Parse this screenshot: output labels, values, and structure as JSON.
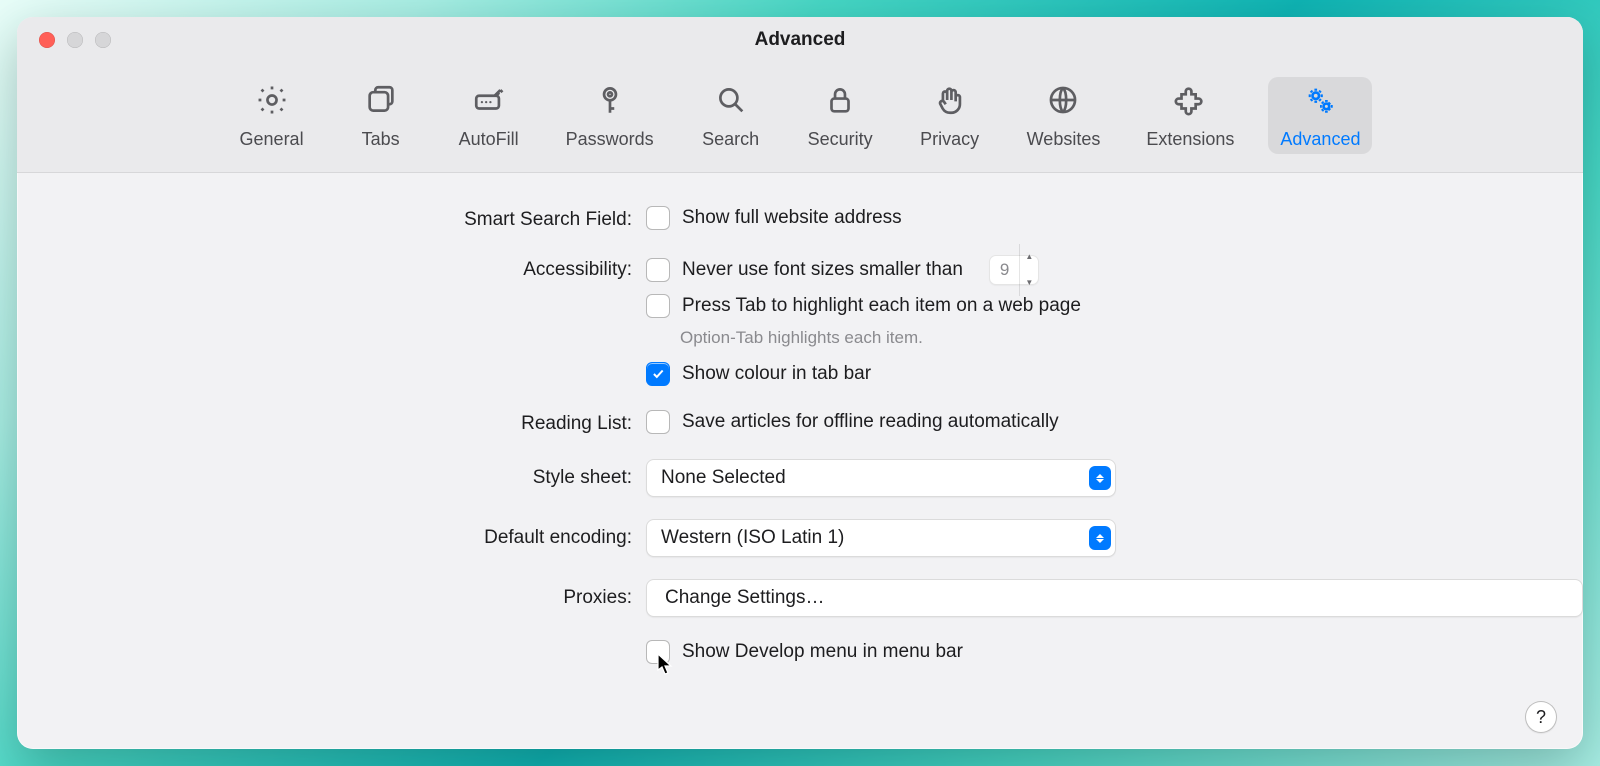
{
  "window": {
    "title": "Advanced"
  },
  "toolbar": {
    "tabs": [
      {
        "id": "general",
        "label": "General"
      },
      {
        "id": "tabs",
        "label": "Tabs"
      },
      {
        "id": "autofill",
        "label": "AutoFill"
      },
      {
        "id": "passwords",
        "label": "Passwords"
      },
      {
        "id": "search",
        "label": "Search"
      },
      {
        "id": "security",
        "label": "Security"
      },
      {
        "id": "privacy",
        "label": "Privacy"
      },
      {
        "id": "websites",
        "label": "Websites"
      },
      {
        "id": "extensions",
        "label": "Extensions"
      },
      {
        "id": "advanced",
        "label": "Advanced",
        "active": true
      }
    ]
  },
  "sections": {
    "smartSearch": {
      "label": "Smart Search Field:",
      "showFullAddress": {
        "checked": false,
        "label": "Show full website address"
      }
    },
    "accessibility": {
      "label": "Accessibility:",
      "minFont": {
        "checked": false,
        "label": "Never use font sizes smaller than",
        "value": "9"
      },
      "pressTab": {
        "checked": false,
        "label": "Press Tab to highlight each item on a web page"
      },
      "hint": "Option-Tab highlights each item.",
      "showColour": {
        "checked": true,
        "label": "Show colour in tab bar"
      }
    },
    "readingList": {
      "label": "Reading List:",
      "saveOffline": {
        "checked": false,
        "label": "Save articles for offline reading automatically"
      }
    },
    "styleSheet": {
      "label": "Style sheet:",
      "value": "None Selected"
    },
    "defaultEncoding": {
      "label": "Default encoding:",
      "value": "Western (ISO Latin 1)"
    },
    "proxies": {
      "label": "Proxies:",
      "button": "Change Settings…"
    },
    "develop": {
      "checked": false,
      "label": "Show Develop menu in menu bar"
    }
  },
  "help": {
    "label": "?"
  }
}
